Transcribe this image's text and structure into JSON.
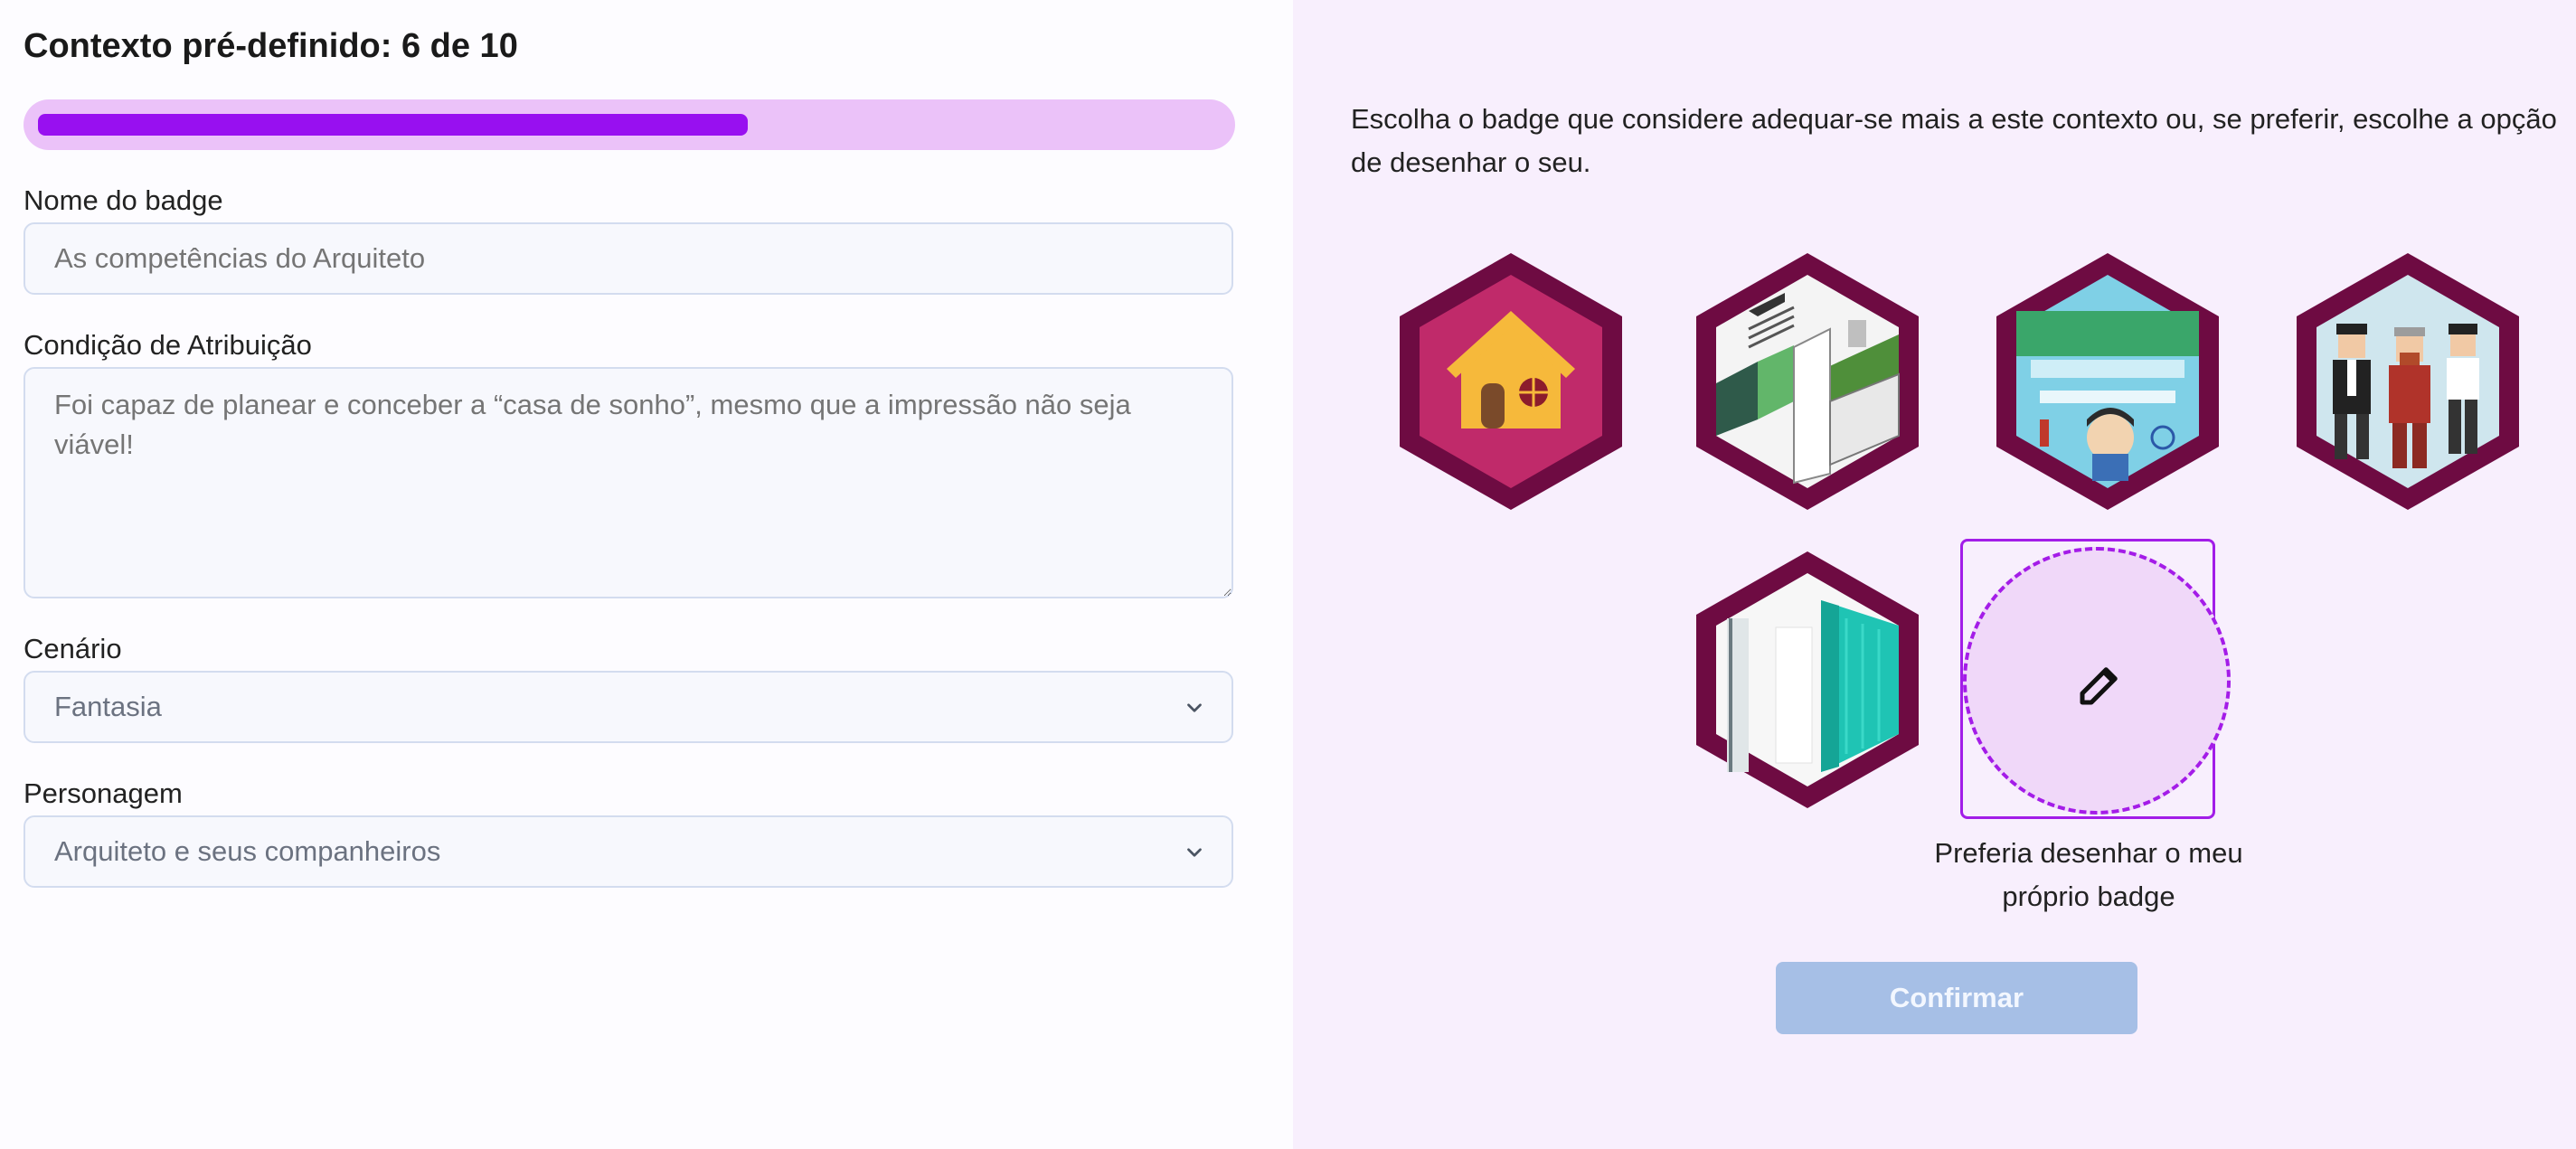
{
  "header": {
    "title": "Contexto pré-definido: 6 de 10",
    "progress_fraction": 0.6
  },
  "form": {
    "badge_name": {
      "label": "Nome do badge",
      "placeholder": "As competências do Arquiteto"
    },
    "condition": {
      "label": "Condição de Atribuição",
      "placeholder": "Foi capaz de planear e conceber a “casa de sonho”, mesmo que a impressão não seja viável!"
    },
    "scenario": {
      "label": "Cenário",
      "value": "Fantasia"
    },
    "character": {
      "label": "Personagem",
      "value": "Arquiteto e seus companheiros"
    }
  },
  "panel": {
    "instructions": "Escolha o badge que considere adequar-se mais a este contexto ou, se preferir, escolhe a opção de desenhar o seu.",
    "badges": [
      {
        "name": "house-badge"
      },
      {
        "name": "isometric-rooms-badge"
      },
      {
        "name": "poster-character-badge"
      },
      {
        "name": "pixel-people-badge"
      },
      {
        "name": "building-facade-badge"
      }
    ],
    "draw_own": {
      "caption": "Preferia desenhar o meu próprio badge",
      "icon": "edit-icon"
    },
    "confirm_label": "Confirmar"
  },
  "colors": {
    "accent": "#9810f0",
    "progress_track": "#ebc2f9",
    "hex_border": "#6e0b42",
    "right_panel_bg": "#f8effd",
    "confirm_disabled": "#a6bfe6"
  }
}
